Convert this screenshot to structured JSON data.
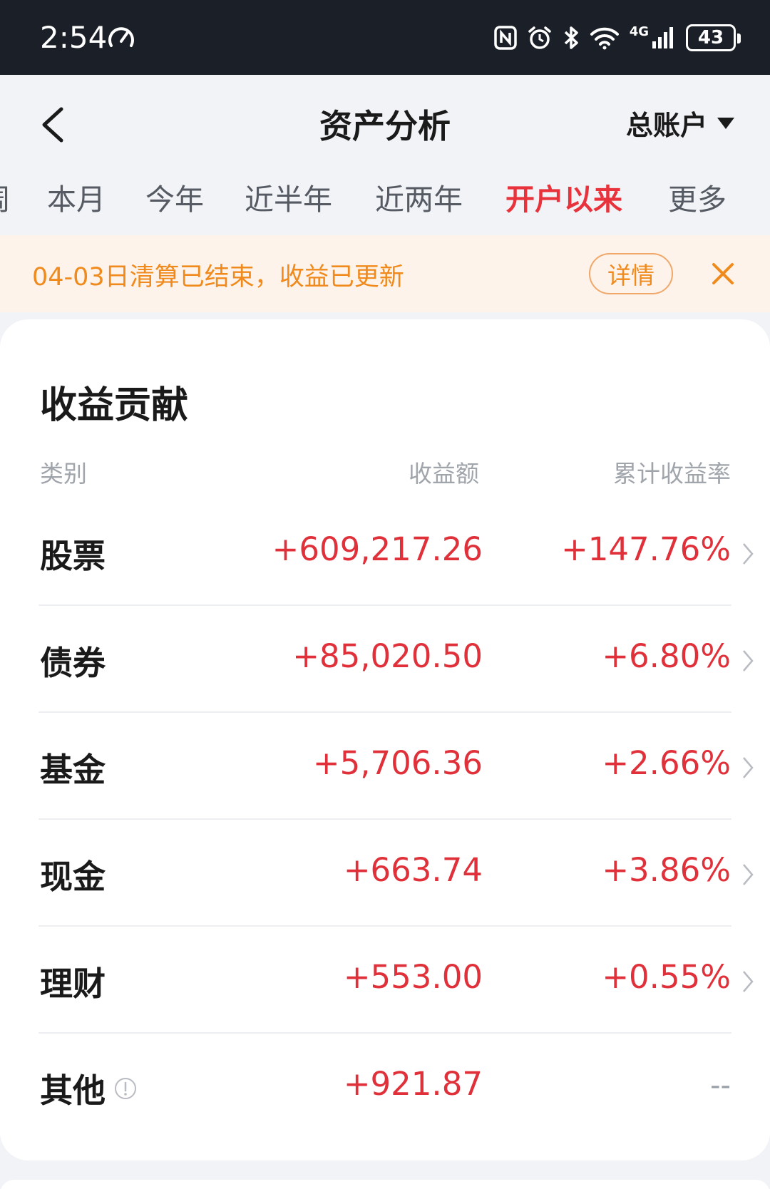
{
  "status_bar": {
    "time": "2:54",
    "network": "4G",
    "battery": "43"
  },
  "header": {
    "title": "资产分析",
    "account": "总账户"
  },
  "tabs": [
    {
      "label": "周"
    },
    {
      "label": "本月"
    },
    {
      "label": "今年"
    },
    {
      "label": "近半年"
    },
    {
      "label": "近两年"
    },
    {
      "label": "开户以来",
      "active": true
    },
    {
      "label": "更多"
    }
  ],
  "notice": {
    "text": "04-03日清算已结束，收益已更新",
    "detail_label": "详情"
  },
  "contribution": {
    "title": "收益贡献",
    "columns": {
      "category": "类别",
      "amount": "收益额",
      "rate": "累计收益率"
    },
    "rows": [
      {
        "category": "股票",
        "amount": "+609,217.26",
        "rate": "+147.76%"
      },
      {
        "category": "债券",
        "amount": "+85,020.50",
        "rate": "+6.80%"
      },
      {
        "category": "基金",
        "amount": "+5,706.36",
        "rate": "+2.66%"
      },
      {
        "category": "现金",
        "amount": "+663.74",
        "rate": "+3.86%"
      },
      {
        "category": "理财",
        "amount": "+553.00",
        "rate": "+0.55%"
      },
      {
        "category": "其他",
        "amount": "+921.87",
        "rate": "--"
      }
    ]
  },
  "colors": {
    "accent_red": "#e0303a",
    "notice_orange": "#f08a1c",
    "status_bg": "#1b1f27"
  }
}
